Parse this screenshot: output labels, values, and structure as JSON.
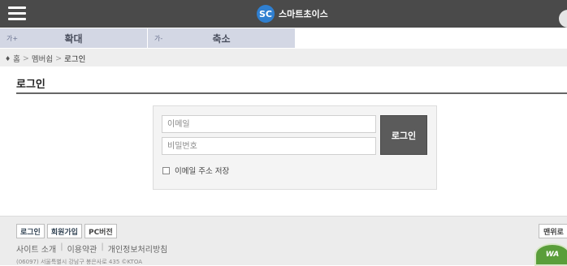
{
  "header": {
    "logo_text": "SC",
    "brand": "스마트초이스",
    "menu_icon": "hamburger-icon"
  },
  "zoom": {
    "in_glyph": "가+",
    "in_label": "확대",
    "out_glyph": "가-",
    "out_label": "축소"
  },
  "breadcrumb": {
    "home_icon": "home-icon",
    "home": "홈",
    "sep": ">",
    "member": "멤버쉽",
    "current": "로그인"
  },
  "page": {
    "title": "로그인"
  },
  "login": {
    "email_placeholder": "이메일",
    "password_placeholder": "비밀번호",
    "submit": "로그인",
    "remember": "이메일 주소 저장"
  },
  "footer": {
    "buttons": [
      "로그인",
      "회원가입",
      "PC버전"
    ],
    "top_button": "맨위로",
    "links": [
      "사이트 소개",
      "이용약관",
      "개인정보처리방침"
    ],
    "link_sep": "|",
    "address": "(06097) 서울특별시 강남구 봉은사로 435 ©KTOA",
    "badge_text": "WA"
  }
}
